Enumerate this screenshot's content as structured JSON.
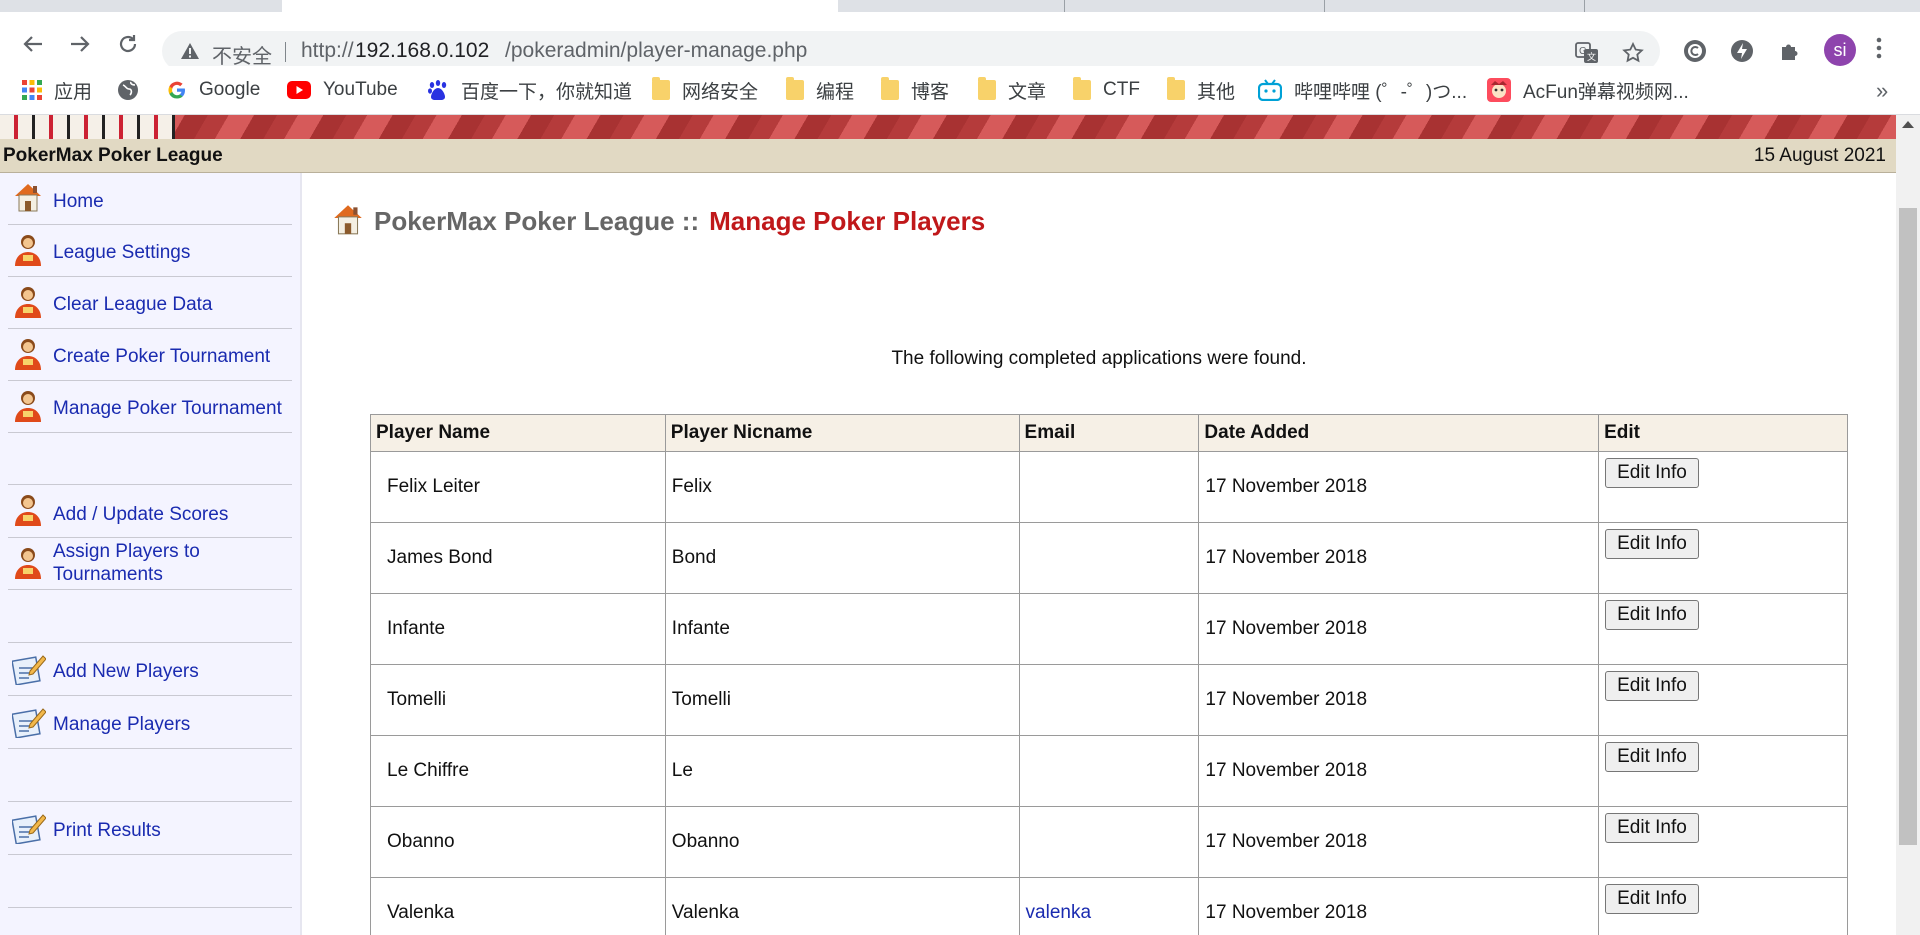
{
  "browser": {
    "insecure_label": "不安全",
    "url_scheme": "http://",
    "url_host": "192.168.0.102",
    "url_path": "/pokeradmin/player-manage.php",
    "profile_initials": "si",
    "bookmarks": [
      {
        "label": "应用",
        "icon": "apps-grid-icon"
      },
      {
        "label": "",
        "icon": "globe-icon"
      },
      {
        "label": "Google",
        "icon": "google-icon"
      },
      {
        "label": "YouTube",
        "icon": "youtube-icon"
      },
      {
        "label": "百度一下，你就知道",
        "icon": "baidu-icon"
      },
      {
        "label": "网络安全",
        "icon": "folder-icon"
      },
      {
        "label": "编程",
        "icon": "folder-icon"
      },
      {
        "label": "博客",
        "icon": "folder-icon"
      },
      {
        "label": "文章",
        "icon": "folder-icon"
      },
      {
        "label": "CTF",
        "icon": "folder-icon"
      },
      {
        "label": "其他",
        "icon": "folder-icon"
      },
      {
        "label": "哔哩哔哩 (゜-゜)つ...",
        "icon": "bilibili-icon"
      },
      {
        "label": "AcFun弹幕视频网...",
        "icon": "acfun-icon"
      }
    ],
    "more_label": "»"
  },
  "header": {
    "league_name": "PokerMax Poker League",
    "date": "15 August 2021"
  },
  "sidebar": {
    "items": [
      {
        "label": "Home",
        "icon": "home-icon"
      },
      {
        "label": "League Settings",
        "icon": "player-icon"
      },
      {
        "label": "Clear League Data",
        "icon": "player-icon"
      },
      {
        "label": "Create Poker Tournament",
        "icon": "player-icon"
      },
      {
        "label": "Manage Poker Tournament",
        "icon": "player-icon"
      },
      {
        "label": "Add / Update Scores",
        "icon": "player-icon"
      },
      {
        "label": "Assign Players to Tournaments",
        "icon": "player-icon"
      },
      {
        "label": "Add New Players",
        "icon": "edit-doc-icon"
      },
      {
        "label": "Manage Players",
        "icon": "edit-doc-icon"
      },
      {
        "label": "Print Results",
        "icon": "edit-doc-icon"
      }
    ]
  },
  "main": {
    "heading_prefix": "PokerMax Poker League ::",
    "heading_title": "Manage Poker Players",
    "intro": "The following completed applications were found.",
    "table": {
      "columns": [
        "Player Name",
        "Player Nicname",
        "Email",
        "Date Added",
        "Edit"
      ],
      "edit_label": "Edit Info",
      "rows": [
        {
          "name": "Felix Leiter",
          "nickname": "Felix",
          "email": "",
          "date": "17 November 2018"
        },
        {
          "name": "James Bond",
          "nickname": "Bond",
          "email": "",
          "date": "17 November 2018"
        },
        {
          "name": "Infante",
          "nickname": "Infante",
          "email": "",
          "date": "17 November 2018"
        },
        {
          "name": "Tomelli",
          "nickname": "Tomelli",
          "email": "",
          "date": "17 November 2018"
        },
        {
          "name": "Le Chiffre",
          "nickname": "Le",
          "email": "",
          "date": "17 November 2018"
        },
        {
          "name": "Obanno",
          "nickname": "Obanno",
          "email": "",
          "date": "17 November 2018"
        },
        {
          "name": "Valenka",
          "nickname": "Valenka",
          "email": "valenka",
          "date": "17 November 2018"
        }
      ]
    }
  },
  "colors": {
    "link": "#1a2bb0",
    "heading_accent": "#c0181a",
    "titlebar_bg": "#e1d9c3",
    "sidebar_bg": "#f4f4ff"
  }
}
